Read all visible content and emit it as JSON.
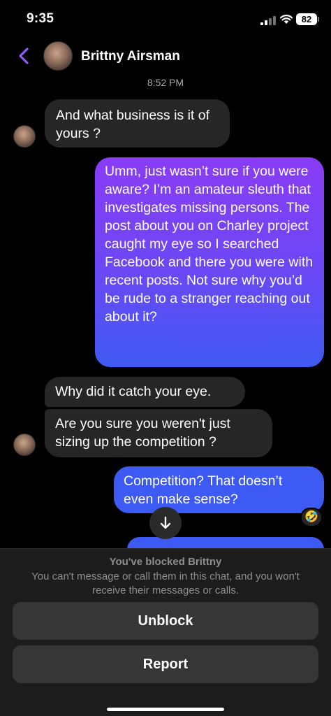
{
  "status_bar": {
    "time": "9:35",
    "battery": "82"
  },
  "header": {
    "contact_name": "Brittny Airsman"
  },
  "timestamp": "8:52 PM",
  "messages": [
    {
      "from": "them",
      "text": "And what business is it of yours ?"
    },
    {
      "from": "me",
      "text": "Umm, just wasn’t sure if you were aware? I’m an amateur sleuth that investigates missing persons. The post about you on Charley project caught my eye so I searched Facebook and there you were with recent posts. Not sure why you’d be rude to a stranger reaching out about it?"
    },
    {
      "from": "them",
      "text": "Why did it catch your eye."
    },
    {
      "from": "them",
      "text": "Are you sure you weren't just sizing up the competition ?"
    },
    {
      "from": "me",
      "text": "Competition? That doesn’t even make sense?"
    }
  ],
  "reaction": "🤣",
  "blocked": {
    "title": "You've blocked Brittny",
    "description": "You can't message or call them in this chat, and you won't receive their messages or calls.",
    "unblock_label": "Unblock",
    "report_label": "Report"
  },
  "colors": {
    "background": "#000000",
    "incoming_bubble": "#262626",
    "outgoing_gradient_top": "#8a3cf5",
    "outgoing_blue": "#3d5bf4",
    "accent_back": "#8b5cf6"
  },
  "icons": {
    "back": "chevron-left-icon",
    "scroll": "arrow-down-icon",
    "signal": "signal-icon",
    "wifi": "wifi-icon",
    "battery": "battery-icon"
  }
}
